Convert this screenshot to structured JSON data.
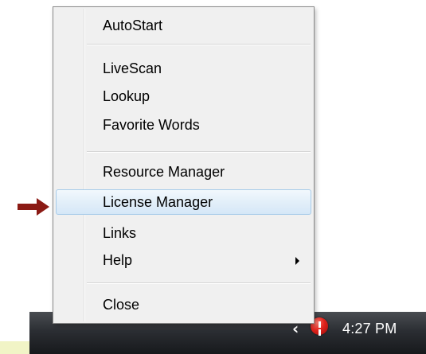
{
  "menu": {
    "items": [
      {
        "label": "AutoStart"
      },
      {
        "label": "LiveScan"
      },
      {
        "label": "Lookup"
      },
      {
        "label": "Favorite Words"
      },
      {
        "label": "Resource Manager"
      },
      {
        "label": "License Manager",
        "highlighted": true
      },
      {
        "label": "Links"
      },
      {
        "label": "Help",
        "has_submenu": true
      },
      {
        "label": "Close"
      }
    ]
  },
  "taskbar": {
    "clock": "4:27 PM",
    "icons": [
      "chevron-left-icon",
      "alert-icon"
    ]
  },
  "colors": {
    "menu_bg": "#f0f0f0",
    "highlight_border": "#a7cbe9",
    "pointer_arrow": "#8b1a14",
    "taskbar": "#2b2e33",
    "yellow_band": "#f1f4c6"
  }
}
